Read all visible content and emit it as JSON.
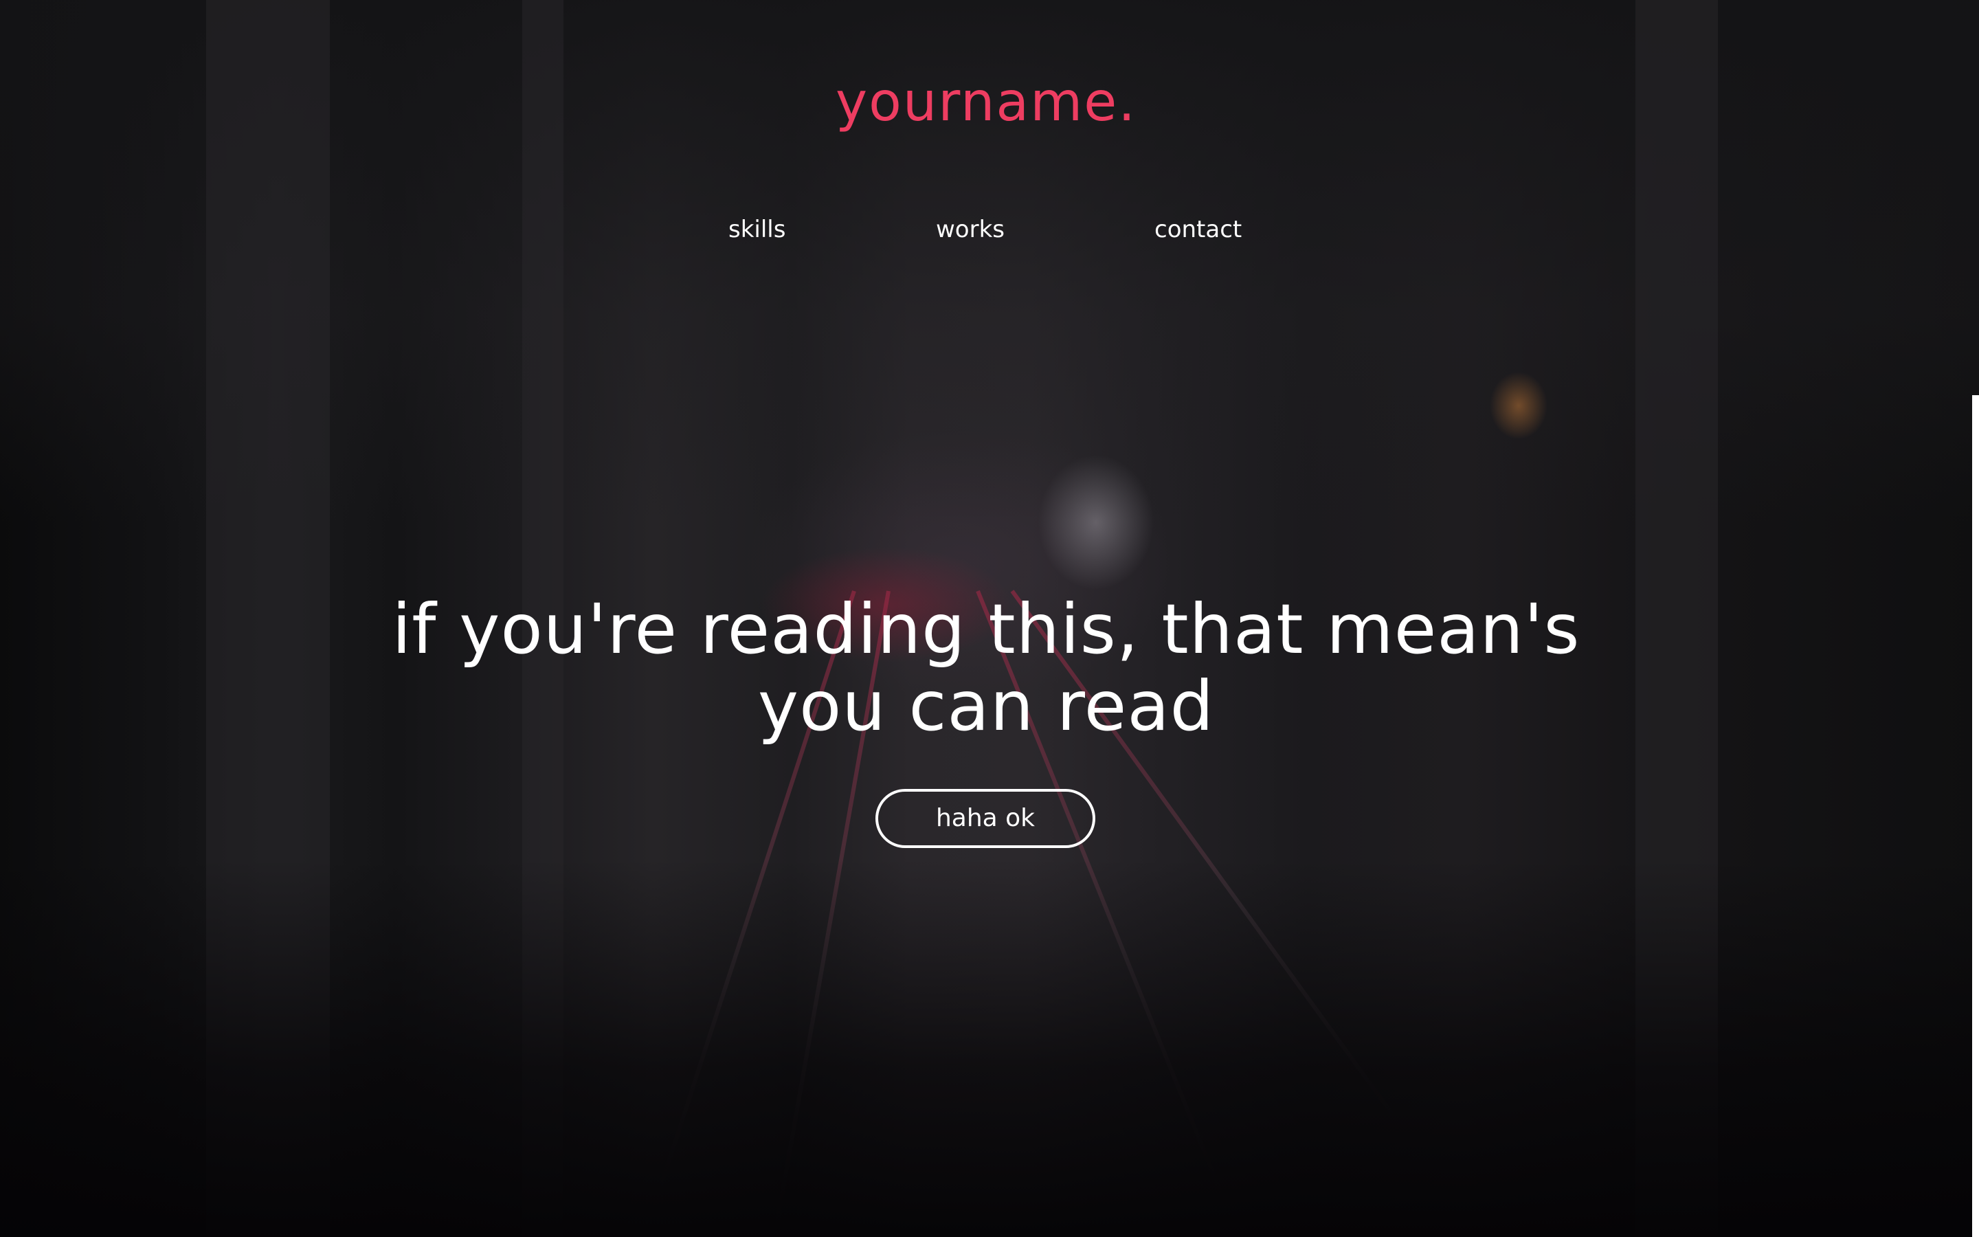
{
  "header": {
    "logo_text": "yourname."
  },
  "nav": {
    "items": [
      {
        "label": "skills"
      },
      {
        "label": "works"
      },
      {
        "label": "contact"
      }
    ]
  },
  "hero": {
    "line1": "if you're reading this, that mean's",
    "line2": "you can read",
    "button_label": "haha ok"
  },
  "colors": {
    "brand_accent": "#ee3d61",
    "text": "#ffffff",
    "background": "#0a090b"
  }
}
